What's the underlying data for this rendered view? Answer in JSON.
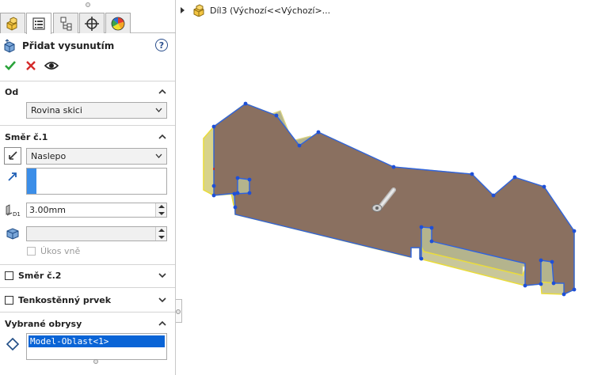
{
  "tabs": [
    {
      "name": "feature-manager-tab",
      "icon": "part-icon"
    },
    {
      "name": "property-manager-tab",
      "icon": "property-list-icon",
      "active": true
    },
    {
      "name": "configuration-manager-tab",
      "icon": "configuration-icon"
    },
    {
      "name": "dimxpert-tab",
      "icon": "crosshair-icon"
    },
    {
      "name": "display-manager-tab",
      "icon": "color-wheel-icon"
    }
  ],
  "header": {
    "title": "Přidat vysunutím",
    "help": "?"
  },
  "from": {
    "label": "Od",
    "value": "Rovina skici"
  },
  "direction1": {
    "label": "Směr č.1",
    "end_condition": "Naslepo",
    "depth": "3.00mm",
    "draft_label": "Úkos vně"
  },
  "direction2": {
    "label": "Směr č.2"
  },
  "thin": {
    "label": "Tenkostěnný prvek"
  },
  "contours": {
    "label": "Vybrané obrysy",
    "items": [
      "Model-Oblast<1>"
    ]
  },
  "tree": {
    "item": "Díl3  (Výchozí<<Výchozí>..."
  },
  "colors": {
    "selection": "#0a64d6",
    "edge_highlight": "#f5e600",
    "sketch_blue": "#2e63e0",
    "face": "#8a7060",
    "top_face": "#e8c896"
  }
}
